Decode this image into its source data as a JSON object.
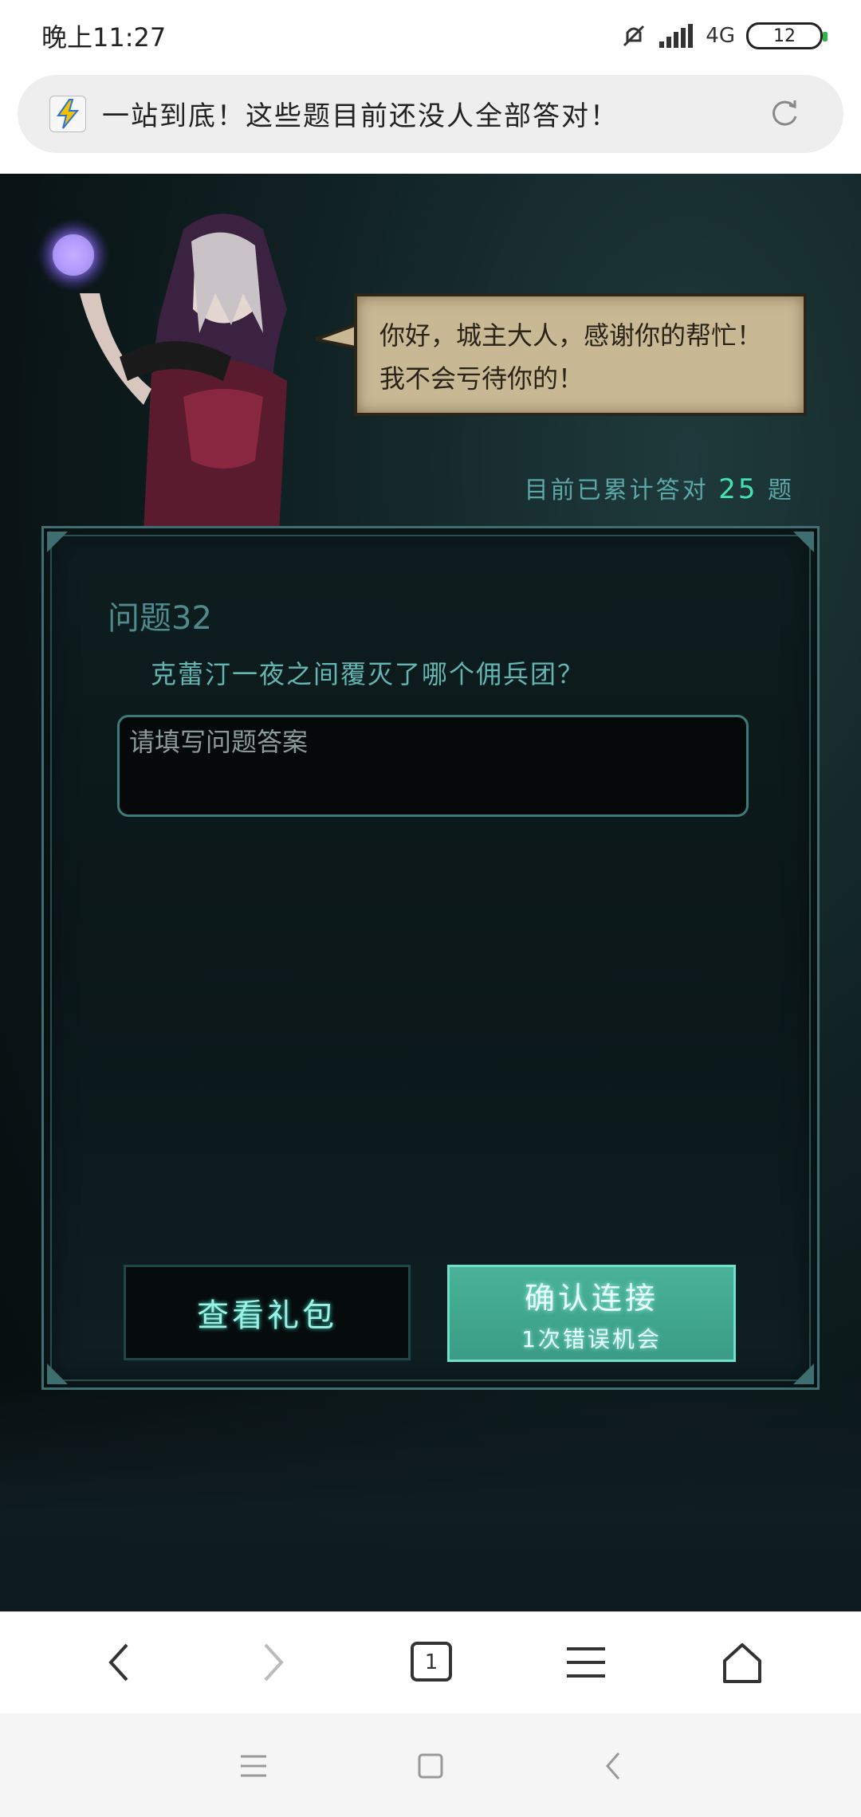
{
  "status_bar": {
    "time": "晚上11:27",
    "network": "4G",
    "battery": "12",
    "icons": [
      "mute-icon",
      "signal-icon",
      "battery-icon"
    ]
  },
  "browser": {
    "tab_title": "一站到底！这些题目前还没人全部答对！",
    "favicon": "favicon-icon",
    "reload_icon": "reload-icon",
    "tab_count": "1"
  },
  "game": {
    "npc_dialog_line1": "你好，城主大人，感谢你的帮忙！",
    "npc_dialog_line2": "我不会亏待你的！",
    "count_prefix": "目前已累计答对",
    "count_value": "25",
    "count_suffix": "题",
    "question_title": "问题32",
    "question_text": "克蕾汀一夜之间覆灭了哪个佣兵团？",
    "answer_placeholder": "请填写问题答案",
    "answer_value": "",
    "gift_button": "查看礼包",
    "confirm_button": "确认连接",
    "confirm_sub": "1次错误机会"
  },
  "browser_nav": {
    "icons": [
      "back-icon",
      "forward-icon",
      "tabs-icon",
      "menu-icon",
      "home-icon"
    ]
  },
  "system_nav": {
    "icons": [
      "recent-apps-icon",
      "home-square-icon",
      "system-back-icon"
    ]
  },
  "colors": {
    "accent": "#42e3b1",
    "panel_border": "#3f6e70",
    "confirm_bg": "#3a9c86",
    "bubble_bg": "#c8b894"
  }
}
